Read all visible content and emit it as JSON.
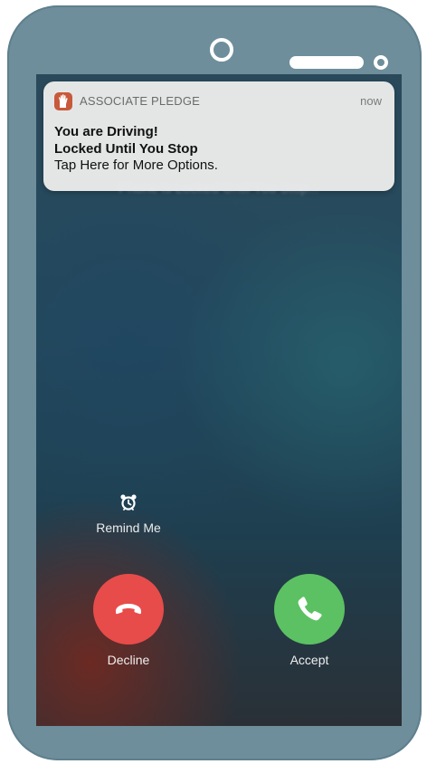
{
  "notification": {
    "app_name": "ASSOCIATE PLEDGE",
    "time": "now",
    "line1": "You are Driving!",
    "line2": "Locked Until You Stop",
    "line3": "Tap Here for More Options.",
    "icon": "hand-icon"
  },
  "background_text": "Phone is Locked Until You Stop...",
  "call_actions": {
    "remind_label": "Remind Me",
    "remind_icon": "alarm-clock-icon",
    "decline_label": "Decline",
    "decline_icon": "phone-hangup-icon",
    "decline_color": "#e74c4a",
    "accept_label": "Accept",
    "accept_icon": "phone-icon",
    "accept_color": "#5cc162"
  },
  "device": {
    "frame_color": "#6e8e9c"
  }
}
